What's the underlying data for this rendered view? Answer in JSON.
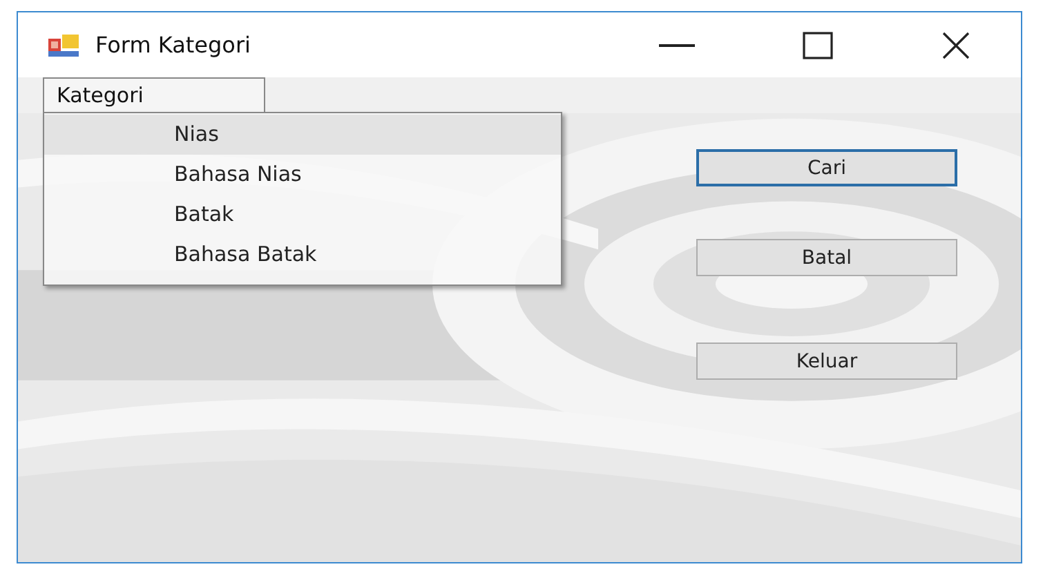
{
  "window": {
    "title": "Form Kategori"
  },
  "menu": [
    {
      "label": "Kategori",
      "open": true,
      "items": [
        {
          "label": "Nias",
          "selected": true
        },
        {
          "label": "Bahasa Nias",
          "selected": false
        },
        {
          "label": "Batak",
          "selected": false
        },
        {
          "label": "Bahasa Batak",
          "selected": false
        }
      ]
    }
  ],
  "buttons": [
    {
      "label": "Cari",
      "focused": true
    },
    {
      "label": "Batal",
      "focused": false
    },
    {
      "label": "Keluar",
      "focused": false
    }
  ]
}
